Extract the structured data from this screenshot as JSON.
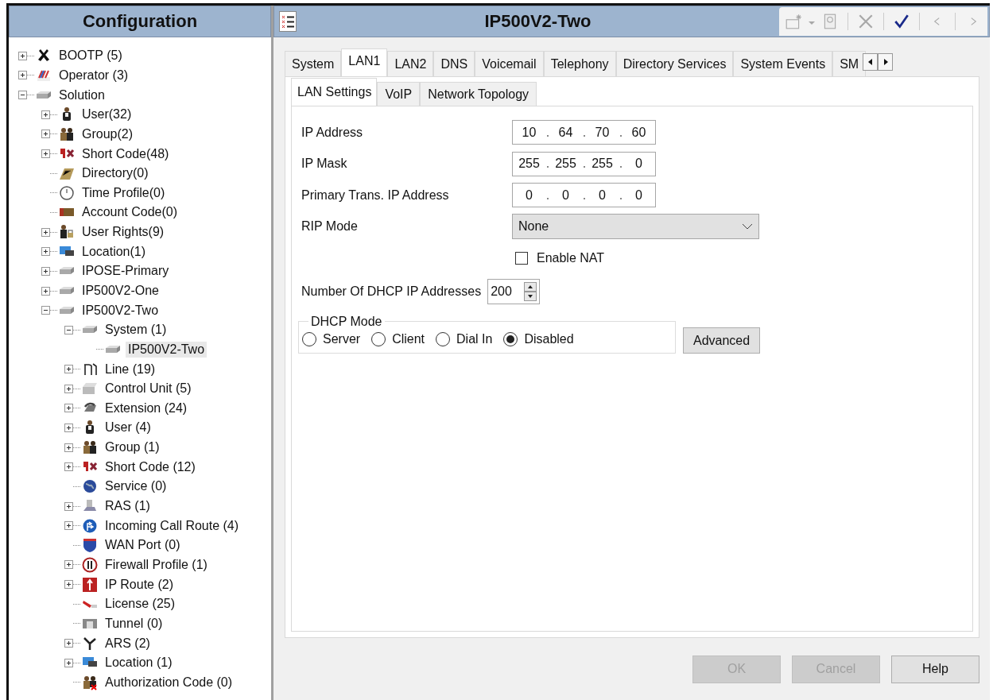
{
  "sidebar": {
    "title": "Configuration",
    "tree": [
      {
        "label": "BOOTP (5)",
        "kind": "bootp",
        "expandable": true,
        "expanded": false,
        "selected": false
      },
      {
        "label": "Operator (3)",
        "kind": "operator",
        "expandable": true,
        "expanded": false,
        "selected": false
      },
      {
        "label": "Solution",
        "kind": "system",
        "expandable": true,
        "expanded": true,
        "selected": false,
        "children": [
          {
            "label": "User(32)",
            "kind": "user",
            "expandable": true,
            "expanded": false,
            "selected": false
          },
          {
            "label": "Group(2)",
            "kind": "group",
            "expandable": true,
            "expanded": false,
            "selected": false
          },
          {
            "label": "Short Code(48)",
            "kind": "shortcode",
            "expandable": true,
            "expanded": false,
            "selected": false
          },
          {
            "label": "Directory(0)",
            "kind": "directory",
            "expandable": false,
            "selected": false
          },
          {
            "label": "Time Profile(0)",
            "kind": "time",
            "expandable": false,
            "selected": false
          },
          {
            "label": "Account Code(0)",
            "kind": "account",
            "expandable": false,
            "selected": false
          },
          {
            "label": "User Rights(9)",
            "kind": "rights",
            "expandable": true,
            "expanded": false,
            "selected": false
          },
          {
            "label": "Location(1)",
            "kind": "location",
            "expandable": true,
            "expanded": false,
            "selected": false
          },
          {
            "label": "IPOSE-Primary",
            "kind": "system",
            "expandable": true,
            "expanded": false,
            "selected": false
          },
          {
            "label": "IP500V2-One",
            "kind": "system",
            "expandable": true,
            "expanded": false,
            "selected": false
          },
          {
            "label": "IP500V2-Two",
            "kind": "system",
            "expandable": true,
            "expanded": true,
            "selected": false,
            "children": [
              {
                "label": "System (1)",
                "kind": "system",
                "expandable": true,
                "expanded": true,
                "selected": false,
                "children": [
                  {
                    "label": "IP500V2-Two",
                    "kind": "system",
                    "expandable": false,
                    "selected": true
                  }
                ]
              },
              {
                "label": "Line (19)",
                "kind": "line",
                "expandable": true,
                "expanded": false,
                "selected": false
              },
              {
                "label": "Control Unit (5)",
                "kind": "control",
                "expandable": true,
                "expanded": false,
                "selected": false
              },
              {
                "label": "Extension (24)",
                "kind": "extension",
                "expandable": true,
                "expanded": false,
                "selected": false
              },
              {
                "label": "User (4)",
                "kind": "user",
                "expandable": true,
                "expanded": false,
                "selected": false
              },
              {
                "label": "Group (1)",
                "kind": "group",
                "expandable": true,
                "expanded": false,
                "selected": false
              },
              {
                "label": "Short Code (12)",
                "kind": "shortcode",
                "expandable": true,
                "expanded": false,
                "selected": false
              },
              {
                "label": "Service (0)",
                "kind": "service",
                "expandable": false,
                "selected": false
              },
              {
                "label": "RAS (1)",
                "kind": "ras",
                "expandable": true,
                "expanded": false,
                "selected": false
              },
              {
                "label": "Incoming Call Route (4)",
                "kind": "icr",
                "expandable": true,
                "expanded": false,
                "selected": false
              },
              {
                "label": "WAN Port (0)",
                "kind": "wan",
                "expandable": false,
                "selected": false
              },
              {
                "label": "Firewall Profile (1)",
                "kind": "firewall",
                "expandable": true,
                "expanded": false,
                "selected": false
              },
              {
                "label": "IP Route (2)",
                "kind": "iproute",
                "expandable": true,
                "expanded": false,
                "selected": false
              },
              {
                "label": "License (25)",
                "kind": "license",
                "expandable": false,
                "selected": false
              },
              {
                "label": "Tunnel (0)",
                "kind": "tunnel",
                "expandable": false,
                "selected": false
              },
              {
                "label": "ARS (2)",
                "kind": "ars",
                "expandable": true,
                "expanded": false,
                "selected": false
              },
              {
                "label": "Location (1)",
                "kind": "location",
                "expandable": true,
                "expanded": false,
                "selected": false
              },
              {
                "label": "Authorization Code (0)",
                "kind": "auth",
                "expandable": false,
                "selected": false
              }
            ]
          }
        ]
      }
    ]
  },
  "editor": {
    "title": "IP500V2-Two",
    "toolbar": [
      {
        "kind": "new",
        "disabled": true
      },
      {
        "kind": "dropdown",
        "disabled": true
      },
      {
        "kind": "export",
        "disabled": true
      },
      {
        "kind": "delete",
        "disabled": true
      },
      {
        "kind": "validate",
        "disabled": false
      },
      {
        "kind": "previous",
        "disabled": true
      },
      {
        "kind": "next",
        "disabled": true
      }
    ],
    "tabs": [
      {
        "label": "System",
        "selected": false
      },
      {
        "label": "LAN1",
        "selected": true
      },
      {
        "label": "LAN2",
        "selected": false
      },
      {
        "label": "DNS",
        "selected": false
      },
      {
        "label": "Voicemail",
        "selected": false
      },
      {
        "label": "Telephony",
        "selected": false
      },
      {
        "label": "Directory Services",
        "selected": false
      },
      {
        "label": "System Events",
        "selected": false
      },
      {
        "label": "SM",
        "selected": false
      }
    ],
    "subtabs": [
      {
        "label": "LAN Settings",
        "selected": true
      },
      {
        "label": "VoIP",
        "selected": false
      },
      {
        "label": "Network Topology",
        "selected": false
      }
    ],
    "fields": [
      {
        "kind": "ip",
        "label": "IP Address",
        "octets": [
          "10",
          "64",
          "70",
          "60"
        ]
      },
      {
        "kind": "ip",
        "label": "IP Mask",
        "octets": [
          "255",
          "255",
          "255",
          "0"
        ]
      },
      {
        "kind": "ip",
        "label": "Primary Trans. IP Address",
        "octets": [
          "0",
          "0",
          "0",
          "0"
        ]
      },
      {
        "kind": "select",
        "label": "RIP Mode",
        "value": "None"
      },
      {
        "kind": "checkbox",
        "label": "Enable NAT",
        "checked": false
      },
      {
        "kind": "spinner",
        "label": "Number Of DHCP IP Addresses",
        "value": "200"
      }
    ],
    "dhcp_mode": {
      "title": "DHCP Mode",
      "options": [
        {
          "label": "Server",
          "selected": false
        },
        {
          "label": "Client",
          "selected": false
        },
        {
          "label": "Dial In",
          "selected": false
        },
        {
          "label": "Disabled",
          "selected": true
        }
      ]
    },
    "advanced_button": "Advanced"
  },
  "buttons": [
    {
      "label": "OK",
      "disabled": true
    },
    {
      "label": "Cancel",
      "disabled": true
    },
    {
      "label": "Help",
      "disabled": false
    }
  ]
}
